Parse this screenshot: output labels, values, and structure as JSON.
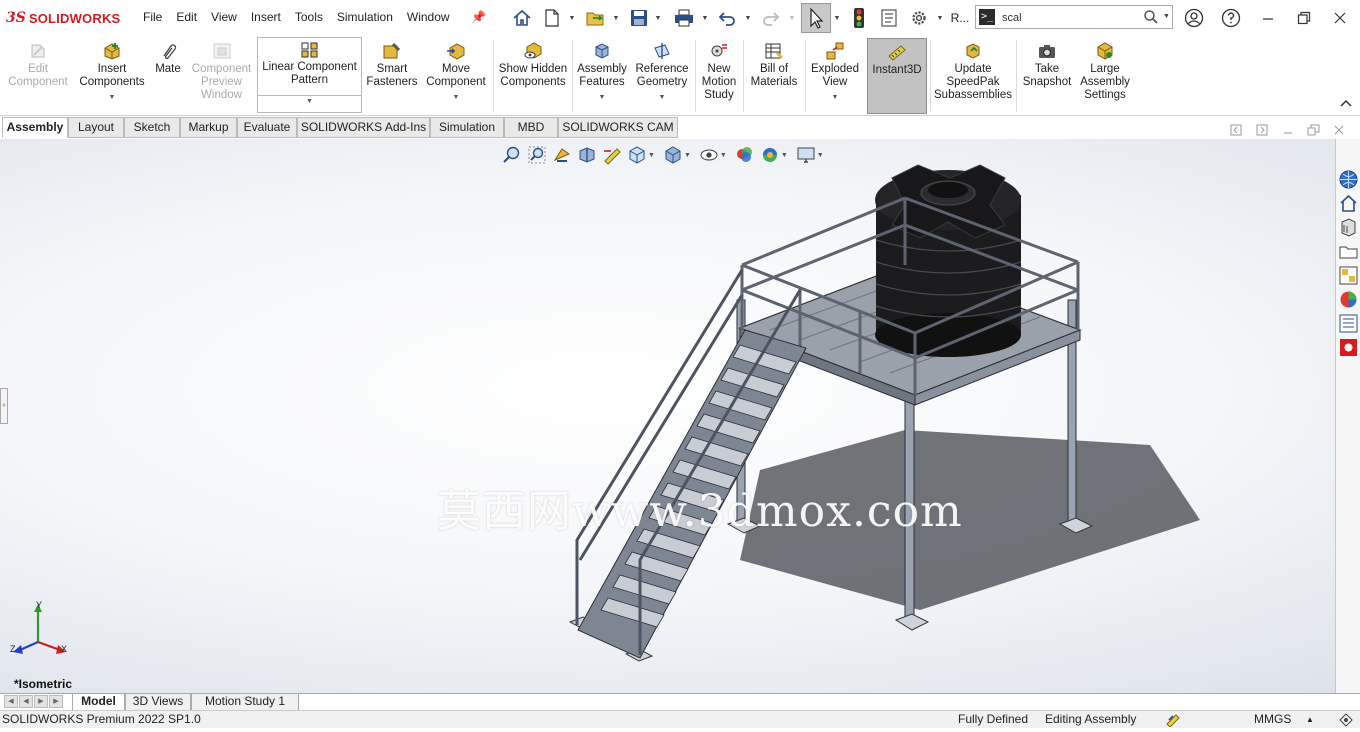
{
  "app": {
    "brand_prefix": "3S",
    "brand_name": "SOLIDWORKS"
  },
  "menu": [
    "File",
    "Edit",
    "View",
    "Insert",
    "Tools",
    "Simulation",
    "Window"
  ],
  "search": {
    "prompt_glyph": ">_",
    "value": "scal",
    "truncated_label": "R..."
  },
  "ribbon": {
    "edit_component": "Edit Component",
    "insert_components": "Insert Components",
    "mate": "Mate",
    "component_preview": "Component Preview Window",
    "linear_pattern": "Linear Component Pattern",
    "smart_fasteners": "Smart Fasteners",
    "move_component": "Move Component",
    "show_hidden": "Show Hidden Components",
    "assembly_features": "Assembly Features",
    "reference_geometry": "Reference Geometry",
    "new_motion_study": "New Motion Study",
    "bill_of_materials": "Bill of Materials",
    "exploded_view": "Exploded View",
    "instant3d": "Instant3D",
    "update_speedpak": "Update SpeedPak Subassemblies",
    "take_snapshot": "Take Snapshot",
    "large_assembly": "Large Assembly Settings"
  },
  "tabs": [
    "Assembly",
    "Layout",
    "Sketch",
    "Markup",
    "Evaluate",
    "SOLIDWORKS Add-Ins",
    "Simulation",
    "MBD",
    "SOLIDWORKS CAM"
  ],
  "active_tab": "Assembly",
  "viewport": {
    "view_label": "*Isometric",
    "watermark": "莫西网www.3dmox.com",
    "axes": {
      "x": "X",
      "y": "Y",
      "z": "Z"
    }
  },
  "bottom_tabs": [
    "Model",
    "3D Views",
    "Motion Study 1"
  ],
  "status": {
    "product": "SOLIDWORKS Premium 2022 SP1.0",
    "definition": "Fully Defined",
    "mode": "Editing Assembly",
    "units": "MMGS"
  },
  "colors": {
    "brand_red": "#d71920",
    "icon_blue": "#2a4f87",
    "tank_black": "#1a1a1a",
    "steel": "#8a93a3"
  }
}
